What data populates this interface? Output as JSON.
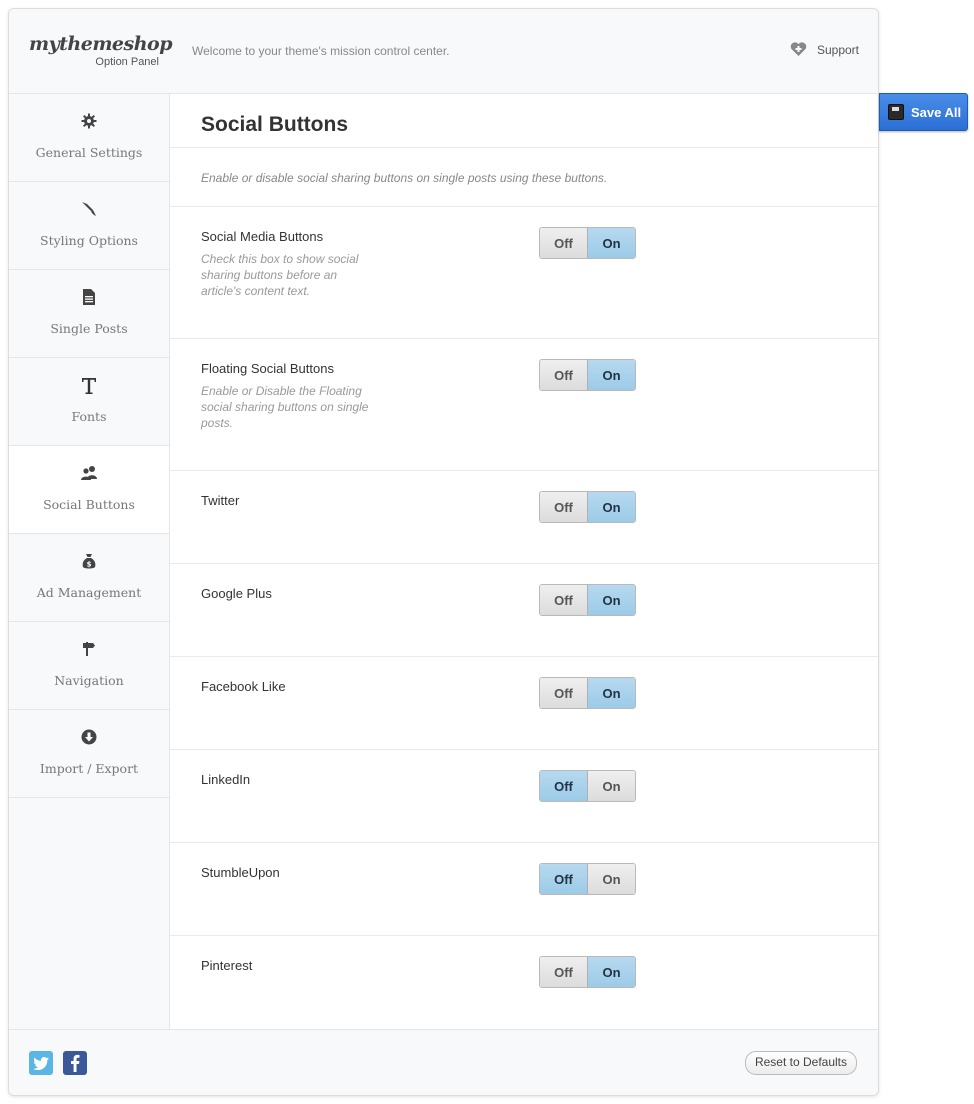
{
  "header": {
    "logo": "mythemeshop",
    "logo_sub": "Option Panel",
    "welcome": "Welcome to your theme's mission control center.",
    "support_label": "Support"
  },
  "save_all_label": "Save All",
  "sidebar": {
    "items": [
      {
        "label": "General Settings",
        "icon": "gear-icon"
      },
      {
        "label": "Styling Options",
        "icon": "brush-icon"
      },
      {
        "label": "Single Posts",
        "icon": "document-icon"
      },
      {
        "label": "Fonts",
        "icon": "font-icon"
      },
      {
        "label": "Social Buttons",
        "icon": "users-icon",
        "active": true
      },
      {
        "label": "Ad Management",
        "icon": "money-bag-icon"
      },
      {
        "label": "Navigation",
        "icon": "signpost-icon"
      },
      {
        "label": "Import / Export",
        "icon": "download-icon"
      }
    ]
  },
  "main": {
    "title": "Social Buttons",
    "intro": "Enable or disable social sharing buttons on single posts using these buttons.",
    "off_label": "Off",
    "on_label": "On",
    "options": [
      {
        "name": "Social Media Buttons",
        "desc": "Check this box to show social sharing buttons before an article's content text.",
        "state": "on"
      },
      {
        "name": "Floating Social Buttons",
        "desc": "Enable or Disable the Floating social sharing buttons on single posts.",
        "state": "on"
      },
      {
        "name": "Twitter",
        "desc": "",
        "state": "on"
      },
      {
        "name": "Google Plus",
        "desc": "",
        "state": "on"
      },
      {
        "name": "Facebook Like",
        "desc": "",
        "state": "on"
      },
      {
        "name": "LinkedIn",
        "desc": "",
        "state": "off"
      },
      {
        "name": "StumbleUpon",
        "desc": "",
        "state": "off"
      },
      {
        "name": "Pinterest",
        "desc": "",
        "state": "on"
      }
    ]
  },
  "footer": {
    "twitter_icon": "twitter-icon",
    "facebook_icon": "facebook-icon",
    "reset_label": "Reset to Defaults"
  },
  "colors": {
    "accent": "#2b6fd6",
    "toggle_selected": "#a9d2ec",
    "twitter": "#5bb6e6",
    "facebook": "#3b5998"
  }
}
